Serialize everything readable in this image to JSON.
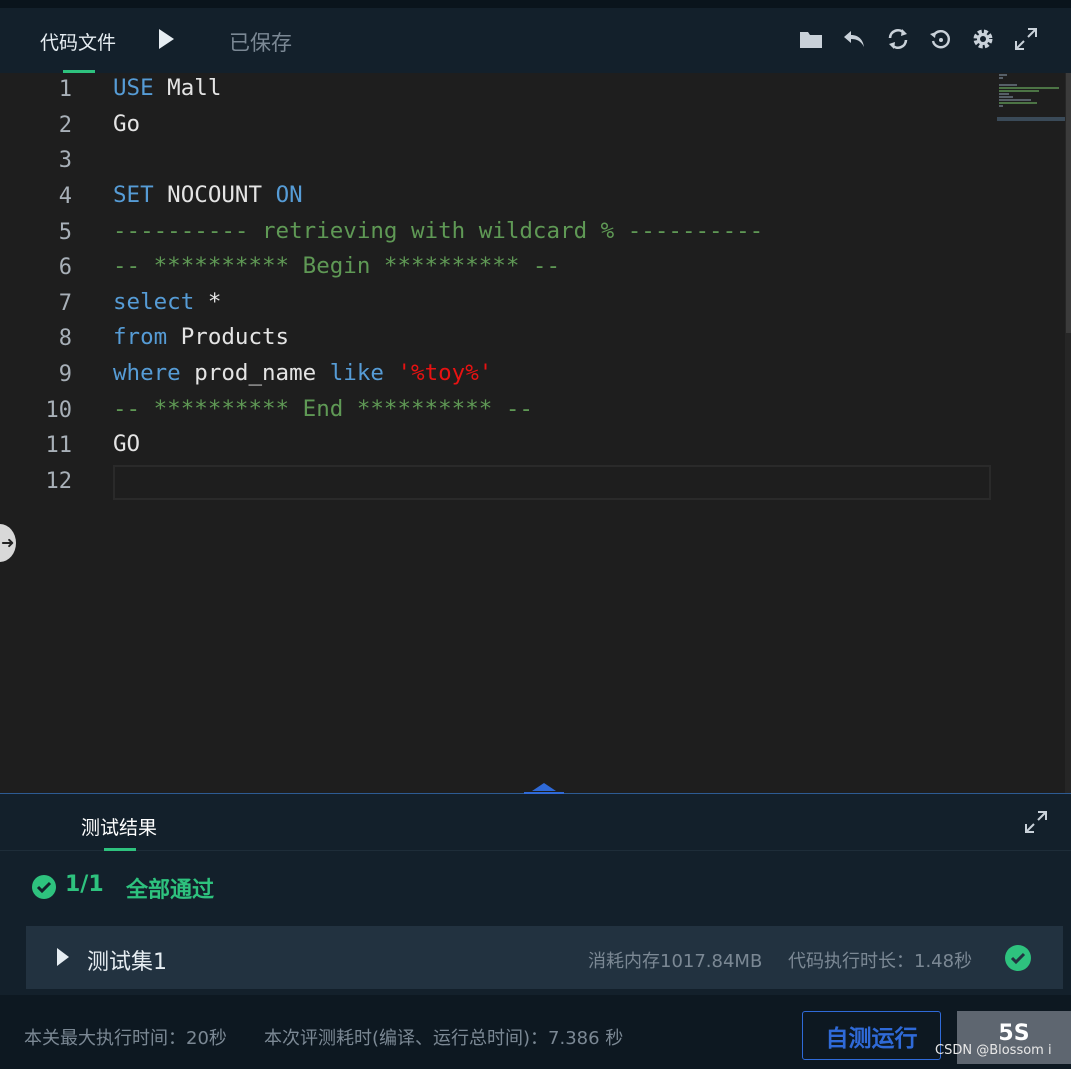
{
  "header": {
    "tab_label": "代码文件",
    "status": "已保存",
    "tools": [
      "folder-icon",
      "undo-icon",
      "refresh-icon",
      "restore-icon",
      "gear-icon",
      "fullscreen-icon"
    ]
  },
  "editor": {
    "line_numbers": [
      "1",
      "2",
      "3",
      "4",
      "5",
      "6",
      "7",
      "8",
      "9",
      "10",
      "11",
      "12"
    ],
    "lines": [
      [
        {
          "t": "USE",
          "c": "kw"
        },
        {
          "t": " Mall",
          "c": ""
        }
      ],
      [
        {
          "t": "Go",
          "c": ""
        }
      ],
      [],
      [
        {
          "t": "SET",
          "c": "kw"
        },
        {
          "t": " NOCOUNT ",
          "c": ""
        },
        {
          "t": "ON",
          "c": "kw"
        }
      ],
      [
        {
          "t": "---------- retrieving with wildcard % ----------",
          "c": "cm"
        }
      ],
      [
        {
          "t": "-- ********** Begin ********** --",
          "c": "cm"
        }
      ],
      [
        {
          "t": "select",
          "c": "kw"
        },
        {
          "t": " *",
          "c": ""
        }
      ],
      [
        {
          "t": "from",
          "c": "kw"
        },
        {
          "t": " Products",
          "c": ""
        }
      ],
      [
        {
          "t": "where",
          "c": "kw"
        },
        {
          "t": " prod_name ",
          "c": ""
        },
        {
          "t": "like",
          "c": "kw"
        },
        {
          "t": " ",
          "c": ""
        },
        {
          "t": "'%toy%'",
          "c": "st"
        }
      ],
      [
        {
          "t": "-- ********** End ********** --",
          "c": "cm"
        }
      ],
      [
        {
          "t": "GO",
          "c": ""
        }
      ],
      []
    ]
  },
  "results": {
    "tab_label": "测试结果",
    "pass_count": "1/1",
    "pass_text": "全部通过",
    "testset_name": "测试集1",
    "memory": "消耗内存1017.84MB",
    "exec_time": "代码执行时长：1.48秒"
  },
  "footer": {
    "max_time": "本关最大执行时间：20秒",
    "total_time": "本次评测耗时(编译、运行总时间)：7.386 秒",
    "run_label": "自测运行",
    "timer_label": "5S",
    "watermark": "CSDN @Blossom i"
  },
  "colors": {
    "accent_green": "#2ec27e",
    "keyword_blue": "#569cd6",
    "comment_green": "#5f9955",
    "string_red": "#e81212",
    "run_blue": "#2f6ad8"
  }
}
